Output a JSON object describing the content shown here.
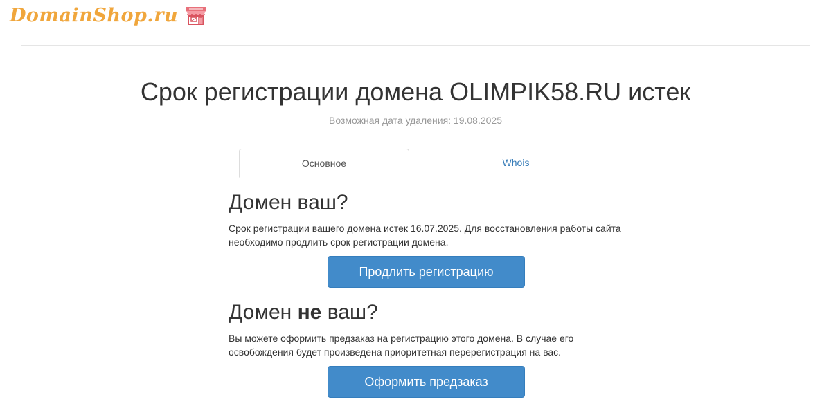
{
  "header": {
    "logo_text": "DomainShop.ru",
    "logo_icon": "storefront-icon",
    "brand_color": "#f0a63c"
  },
  "main": {
    "title": "Срок регистрации домена OLIMPIK58.RU истек",
    "subtitle": "Возможная дата удаления: 19.08.2025",
    "tabs": [
      {
        "label": "Основное",
        "active": true
      },
      {
        "label": "Whois",
        "active": false
      }
    ]
  },
  "owner_section": {
    "heading_part1": "Домен ваш?",
    "text": "Срок регистрации вашего домена истек 16.07.2025. Для восстановления работы сайта необходимо продлить срок регистрации домена.",
    "button_label": "Продлить регистрацию"
  },
  "not_owner_section": {
    "heading_before": "Домен ",
    "heading_bold": "не",
    "heading_after": " ваш?",
    "text": "Вы можете оформить предзаказ на регистрацию этого домена. В случае его освобождения будет произведена приоритетная перерегистрация на вас.",
    "button_label": "Оформить предзаказ"
  },
  "colors": {
    "button_bg": "#428bca",
    "link": "#337ab7"
  }
}
